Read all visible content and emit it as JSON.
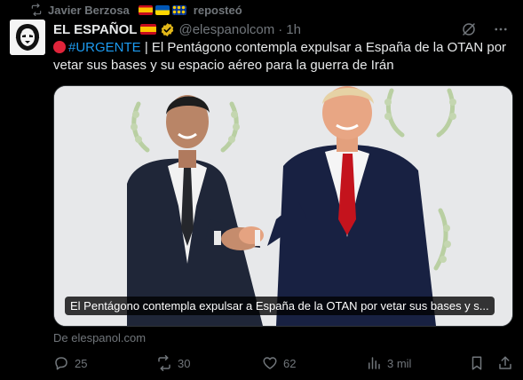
{
  "repost": {
    "user": "Javier Berzosa",
    "action": "reposteó",
    "flags": [
      "spain",
      "ukraine",
      "eu"
    ]
  },
  "tweet": {
    "author_name": "EL ESPAÑOL",
    "handle": "@elespanolcom",
    "separator": "·",
    "time": "1h",
    "hashtag": "#URGENTE",
    "text": " | El Pentágono contempla expulsar a España de la OTAN por vetar sus bases y su espacio aéreo para la guerra de Irán"
  },
  "card": {
    "caption": "El Pentágono contempla expulsar a España de la OTAN por vetar sus bases y s...",
    "source": "De elespanol.com"
  },
  "actions": {
    "replies": "25",
    "reposts": "30",
    "likes": "62",
    "views": "3 mil"
  },
  "colors": {
    "background": "#000000",
    "text": "#e7e9ea",
    "muted": "#71767b",
    "link": "#1d9bf0",
    "urgent_red": "#e0243a",
    "verified_gold": "#e2b719"
  },
  "icons": {
    "repost": "repost-icon",
    "verified": "verified-badge-icon",
    "grok": "grok-icon",
    "more": "more-icon",
    "reply": "reply-icon",
    "retweet": "retweet-icon",
    "like": "heart-icon",
    "views": "views-icon",
    "bookmark": "bookmark-icon",
    "share": "share-icon"
  }
}
